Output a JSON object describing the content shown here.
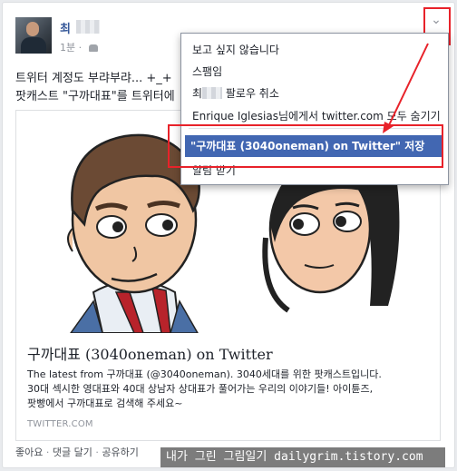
{
  "post": {
    "author_initial": "최",
    "timestamp": "1분",
    "separator": "·",
    "line1": "트위터 계정도 부랴부랴... +_+",
    "line2": "팟캐스트 \"구까대표\"를 트위터에"
  },
  "link": {
    "title": "구까대표 (3040oneman) on Twitter",
    "desc_line1": "The latest from 구까대표 (@3040oneman). 3040세대를 위한 팟캐스트입니다.",
    "desc_line2": "30대 섹시한 영대표와 40대 상남자 상대표가 풀어가는 우리의 이야기들! 아이튠즈,",
    "desc_line3": "팟빵에서 구까대표로 검색해 주세요~",
    "domain": "TWITTER.COM"
  },
  "menu": {
    "item1": "보고 싶지 않습니다",
    "item2": "스팸임",
    "item3_prefix": "최",
    "item3_suffix": "팔로우 취소",
    "item4": "Enrique Iglesias님에게서 twitter.com 모두 숨기기",
    "item5": "\"구까대표 (3040oneman) on Twitter\" 저장",
    "item6": "알림 받기"
  },
  "actions": {
    "like": "좋아요",
    "comment": "댓글 달기",
    "share": "공유하기",
    "sep": "·"
  },
  "watermark": "내가 그린 그림일기 dailygrim.tistory.com",
  "icons": {
    "chevron": "chevron-down-icon",
    "audience": "friends-icon"
  },
  "colors": {
    "selected_menu": "#4267b2",
    "annotation": "#e8222a",
    "link": "#365899"
  }
}
